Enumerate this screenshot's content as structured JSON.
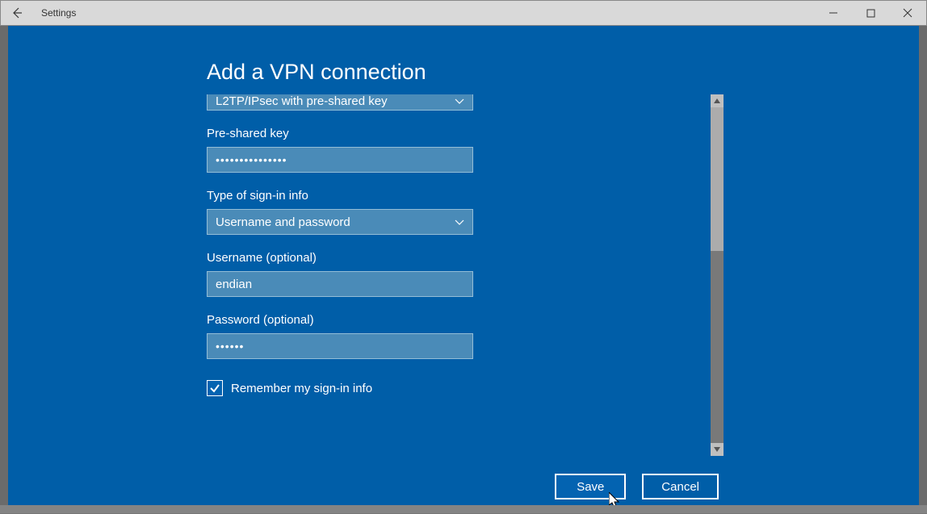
{
  "window": {
    "title": "Settings"
  },
  "dialog": {
    "heading": "Add a VPN connection",
    "vpn_type": {
      "value": "L2TP/IPsec with pre-shared key"
    },
    "psk": {
      "label": "Pre-shared key",
      "value": "•••••••••••••••"
    },
    "signin_type": {
      "label": "Type of sign-in info",
      "value": "Username and password"
    },
    "username": {
      "label": "Username (optional)",
      "value": "endian"
    },
    "password": {
      "label": "Password (optional)",
      "value": "••••••"
    },
    "remember": {
      "label": "Remember my sign-in info",
      "checked": true
    },
    "save_label": "Save",
    "cancel_label": "Cancel"
  }
}
